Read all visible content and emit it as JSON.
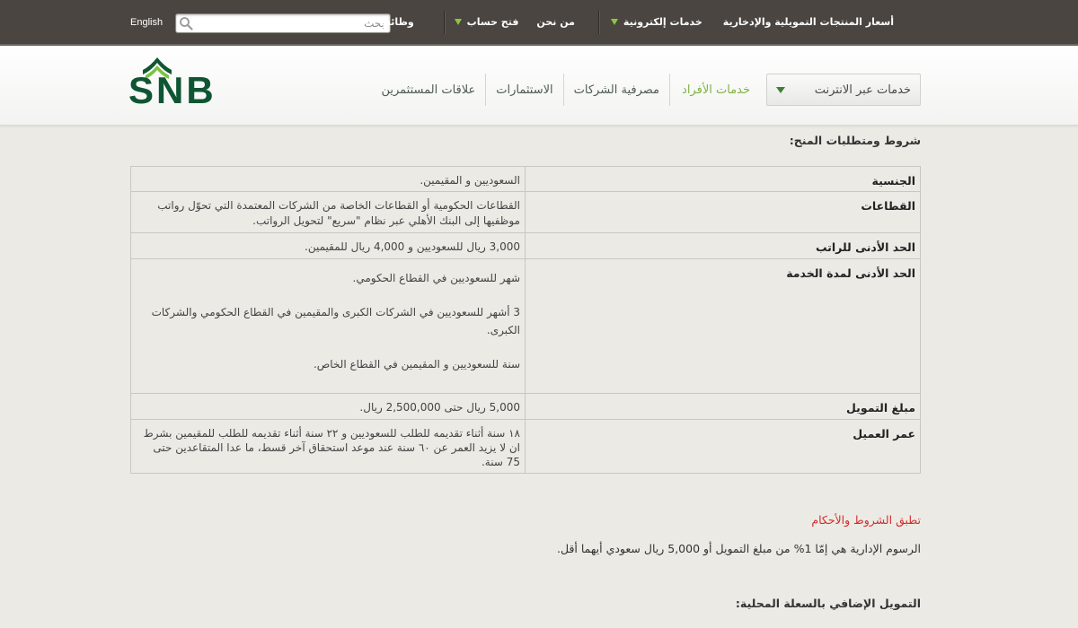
{
  "colors": {
    "top_bar_bg": "#4a4541",
    "accent_green": "#8dc63f",
    "dropdown_green": "#3f7f33",
    "nav_text": "#4d5b56",
    "nav_active": "#7fb241",
    "logo_dark_green": "#0f5533",
    "logo_light_green": "#7cc242",
    "page_bg": "#eceae5",
    "table_border": "#c9c7c2",
    "terms_red": "#d52b2b",
    "body_text": "#333333"
  },
  "icons": {
    "search": "search-icon",
    "dropdown": "chevron-down-icon",
    "logo_mark": "snb-logo-mark-icon"
  },
  "top_bar": {
    "language_link": "English",
    "search": {
      "placeholder": "بحث",
      "value": ""
    },
    "links": {
      "rates": "أسعار المنتجات التمويلية والإدخارية",
      "e_services": "خدمات إلكترونية",
      "about_us": "من نحن",
      "open_account": "فتح حساب",
      "jobs": "وظائف"
    }
  },
  "header": {
    "logo_text": "SNB",
    "online_services": "خدمات عبر الانترنت",
    "nav": [
      {
        "label": "خدمات الأفراد",
        "active": true
      },
      {
        "label": "مصرفية الشركات",
        "active": false
      },
      {
        "label": "الاستثمارات",
        "active": false
      },
      {
        "label": "علاقات المستثمرين",
        "active": false
      }
    ]
  },
  "main": {
    "heading": "شروط ومتطلبات المنح:",
    "table": [
      {
        "label": "الجنسية",
        "values": [
          "السعوديين و المقيمين."
        ]
      },
      {
        "label": "القطاعات",
        "values": [
          "القطاعات الحكومية أو القطاعات الخاصة من الشركات المعتمدة التي تحوّل رواتب موظفيها إلى البنك الأهلي عبر نظام \"سريع\" لتحويل الرواتب."
        ]
      },
      {
        "label": "الحد الأدنى للراتب",
        "values": [
          "3,000 ريال للسعوديين و 4,000 ريال للمقيمين."
        ]
      },
      {
        "label": "الحد الأدنى لمدة الخدمة",
        "values": [
          "شهر للسعوديين في القطاع الحكومي.",
          "3 أشهر للسعوديين في الشركات الكبرى والمقيمين في القطاع الحكومي والشركات الكبرى.",
          "سنة للسعوديين و المقيمين في القطاع الخاص."
        ]
      },
      {
        "label": "مبلغ التمويل",
        "values": [
          "5,000 ريال حتى 2,500,000 ريال."
        ]
      },
      {
        "label": "عمر العميل",
        "values": [
          "١٨ سنة أثناء تقديمه للطلب للسعوديين و ٢٢ سنة أثناء تقديمه للطلب للمقيمين بشرط ان لا يزيد العمر عن ٦٠ سنة عند موعد استحقاق آخر قسط، ما عدا المتقاعدين حتى 75 سنة."
        ]
      }
    ],
    "terms_note": "تطبق الشروط والأحكام",
    "fees_text": "الرسوم الإدارية هي إمّا 1% من مبلغ التمويل أو 5,000 ريال سعودي أيهما أقل.",
    "next_heading": "التمويل الإضافي بالسعلة المحلية:"
  }
}
